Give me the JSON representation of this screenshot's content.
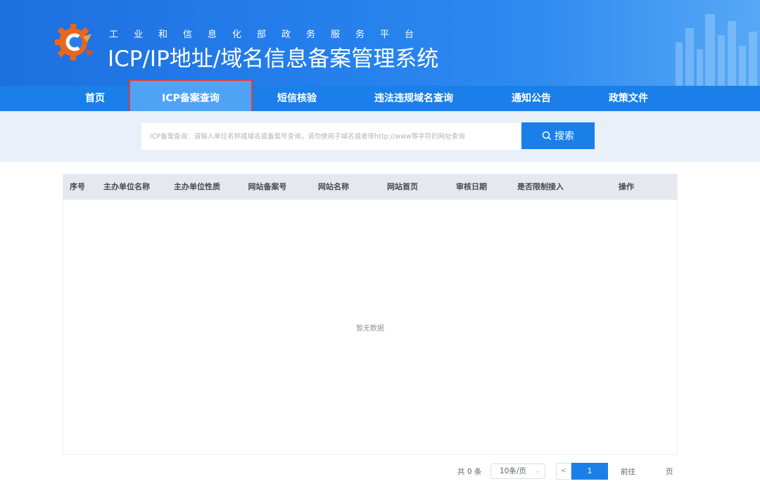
{
  "header": {
    "subtitle": "工业和信息化部政务服务平台",
    "title": "ICP/IP地址/域名信息备案管理系统"
  },
  "nav": {
    "items": [
      {
        "label": "首页"
      },
      {
        "label": "ICP备案查询",
        "active": true
      },
      {
        "label": "短信核验"
      },
      {
        "label": "违法违规域名查询"
      },
      {
        "label": "通知公告"
      },
      {
        "label": "政策文件"
      }
    ]
  },
  "search": {
    "placeholder": "ICP备案查询：请输入单位名称或域名或备案号查询，请勿使用子域名或者带http://www等字符的网址查询",
    "button_label": "搜索",
    "icon": "search-icon"
  },
  "table": {
    "columns": [
      "序号",
      "主办单位名称",
      "主办单位性质",
      "网站备案号",
      "网站名称",
      "网站首页",
      "审核日期",
      "是否限制接入",
      "操作"
    ],
    "rows": [],
    "empty_text": "暂无数据"
  },
  "pagination": {
    "total_text": "共 0 条",
    "page_size": "10条/页",
    "current_page": "1",
    "goto_label": "前往",
    "goto_suffix": "页"
  },
  "colors": {
    "header_blue": "#1e6fe0",
    "nav_blue": "#1a7fe8",
    "active_tab": "#4fa3f6",
    "highlight_border": "#e23b3b"
  }
}
